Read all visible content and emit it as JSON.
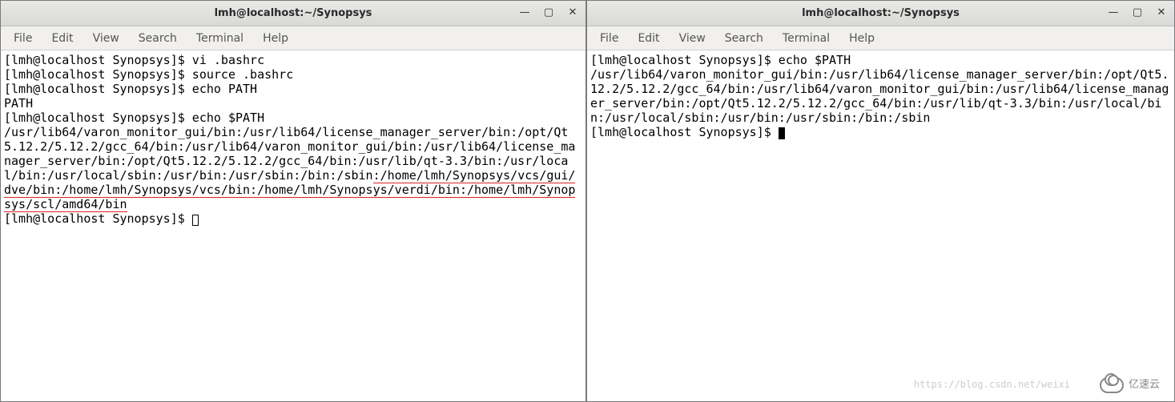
{
  "left": {
    "title": "lmh@localhost:~/Synopsys",
    "menu": [
      "File",
      "Edit",
      "View",
      "Search",
      "Terminal",
      "Help"
    ],
    "lines": [
      "[lmh@localhost Synopsys]$ vi .bashrc",
      "[lmh@localhost Synopsys]$ source .bashrc",
      "[lmh@localhost Synopsys]$ echo PATH",
      "PATH",
      "[lmh@localhost Synopsys]$ echo $PATH",
      "/usr/lib64/varon_monitor_gui/bin:/usr/lib64/license_manager_server/bin:/opt/Qt5.12.2/5.12.2/gcc_64/bin:/usr/lib64/varon_monitor_gui/bin:/usr/lib64/license_manager_server/bin:/opt/Qt5.12.2/5.12.2/gcc_64/bin:/usr/lib/qt-3.3/bin:/usr/local/bin:/usr/local/sbin:/usr/bin:/usr/sbin:/bin:/sbin"
    ],
    "underlined": ":/home/lmh/Synopsys/vcs/gui/dve/bin:/home/lmh/Synopsys/vcs/bin:/home/lmh/Synopsys/verdi/bin:/home/lmh/Synopsys/scl/amd64/bin",
    "prompt_after": "[lmh@localhost Synopsys]$ "
  },
  "right": {
    "title": "lmh@localhost:~/Synopsys",
    "menu": [
      "File",
      "Edit",
      "View",
      "Search",
      "Terminal",
      "Help"
    ],
    "lines": [
      "[lmh@localhost Synopsys]$ echo $PATH",
      "/usr/lib64/varon_monitor_gui/bin:/usr/lib64/license_manager_server/bin:/opt/Qt5.12.2/5.12.2/gcc_64/bin:/usr/lib64/varon_monitor_gui/bin:/usr/lib64/license_manager_server/bin:/opt/Qt5.12.2/5.12.2/gcc_64/bin:/usr/lib/qt-3.3/bin:/usr/local/bin:/usr/local/sbin:/usr/bin:/usr/sbin:/bin:/sbin"
    ],
    "prompt_after": "[lmh@localhost Synopsys]$ "
  },
  "watermark": "亿速云",
  "faint_text": "https://blog.csdn.net/weixi"
}
